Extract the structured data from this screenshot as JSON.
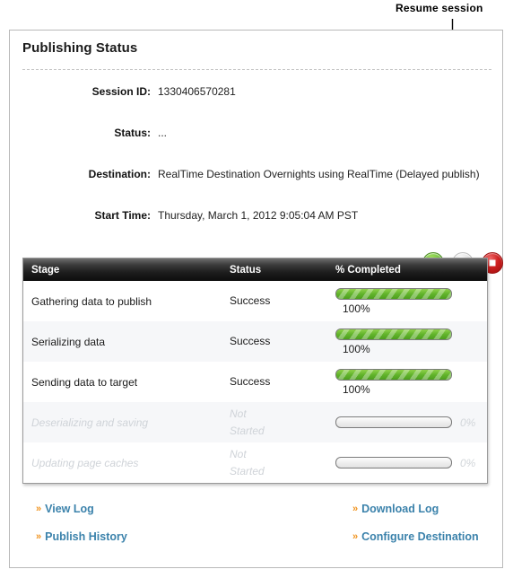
{
  "annotation": {
    "label": "Resume session",
    "target": "resume-session-button"
  },
  "panel": {
    "title": "Publishing Status",
    "fields": [
      {
        "label": "Session ID:",
        "value": "1330406570281"
      },
      {
        "label": "Status:",
        "value": "..."
      },
      {
        "label": "Destination:",
        "value": "RealTime Destination Overnights using RealTime (Delayed publish)"
      },
      {
        "label": "Start Time:",
        "value": "Thursday, March 1, 2012 9:05:04 AM PST"
      }
    ]
  },
  "controls": [
    {
      "name": "start-session-button",
      "icon": "play-icon",
      "state": "enabled",
      "color": "#7ac943"
    },
    {
      "name": "resume-session-button",
      "icon": "rewind-icon",
      "state": "disabled",
      "color": "#d8d8d8"
    },
    {
      "name": "stop-session-button",
      "icon": "stop-icon",
      "state": "enabled",
      "color": "#cf2020"
    }
  ],
  "table": {
    "columns": [
      "Stage",
      "Status",
      "% Completed"
    ],
    "rows": [
      {
        "stage": "Gathering data to publish",
        "status": "Success",
        "percent": "100%",
        "value": 100,
        "state": "done"
      },
      {
        "stage": "Serializing data",
        "status": "Success",
        "percent": "100%",
        "value": 100,
        "state": "done"
      },
      {
        "stage": "Sending data to target",
        "status": "Success",
        "percent": "100%",
        "value": 100,
        "state": "done"
      },
      {
        "stage": "Deserializing and saving",
        "status": "Not\nStarted",
        "percent": "0%",
        "value": 0,
        "state": "pending"
      },
      {
        "stage": "Updating page caches",
        "status": "Not\nStarted",
        "percent": "0%",
        "value": 0,
        "state": "pending"
      }
    ]
  },
  "links": [
    {
      "label": "View Log",
      "name": "view-log-link"
    },
    {
      "label": "Download Log",
      "name": "download-log-link"
    },
    {
      "label": "Publish History",
      "name": "publish-history-link"
    },
    {
      "label": "Configure Destination",
      "name": "configure-destination-link"
    }
  ],
  "colors": {
    "link": "#3b82ab",
    "chevron": "#f0931f",
    "progress_fill": "#63b52c",
    "header_bg": "#1d1d1d"
  }
}
